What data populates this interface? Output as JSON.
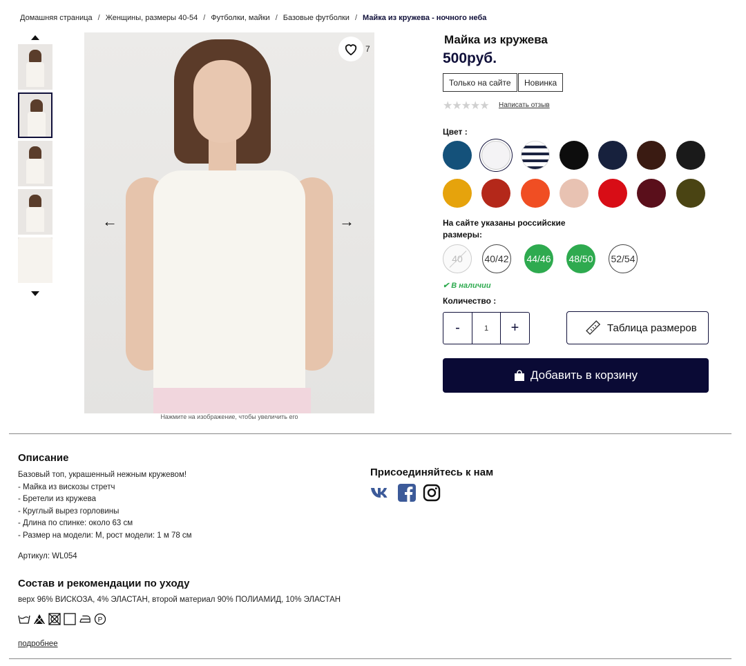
{
  "breadcrumb": [
    "Домашняя страница",
    "Женщины, размеры 40-54",
    "Футболки, майки",
    "Базовые футболки",
    "Майка из кружева - ночного неба"
  ],
  "breadcrumb_sep": "/",
  "gallery": {
    "favorite_count": "7",
    "zoom_hint": "Нажмите на изображение, чтобы увеличить его"
  },
  "product": {
    "title": "Майка из кружева",
    "price": "500руб.",
    "badges": [
      "Только на сайте",
      "Новинка"
    ],
    "review_link": "Написать отзыв",
    "rating": 0,
    "color_label": "Цвет :",
    "colors": [
      "#14517a",
      "#f4f3f5",
      "striped",
      "#0d0d0d",
      "#17213d",
      "#3a1b12",
      "#1a1a1a",
      "#e6a30c",
      "#b4281a",
      "#f04e23",
      "#e8c2b2",
      "#d80d16",
      "#5a0f1b",
      "#4a4413"
    ],
    "sizes_label_1": "На сайте указаны российские",
    "sizes_label_2": "размеры:",
    "sizes": [
      "40",
      "40/42",
      "44/46",
      "48/50",
      "52/54"
    ],
    "stock": "В наличии",
    "qty_label": "Количество :",
    "qty_minus": "-",
    "qty_value": "1",
    "qty_plus": "+",
    "size_table": "Таблица размеров",
    "add_to_cart": "Добавить в корзину"
  },
  "description": {
    "heading": "Описание",
    "text": "Базовый топ, украшенный нежным кружевом!\n- Майка из вискозы стретч\n- Бретели из кружева\n- Круглый вырез горловины\n- Длина по спинке: около 63 см\n- Размер на модели: M, рост модели: 1 м 78 см",
    "sku": "Артикул: WL054"
  },
  "composition": {
    "heading": "Состав и рекомендации по уходу",
    "text": "верх 96% ВИСКОЗА, 4% ЭЛАСТАН, второй материал 90% ПОЛИАМИД, 10% ЭЛАСТАН",
    "more": "подробнее"
  },
  "social": {
    "heading": "Присоединяйтесь к нам",
    "networks": [
      "vk-icon",
      "facebook-icon",
      "instagram-icon"
    ]
  }
}
